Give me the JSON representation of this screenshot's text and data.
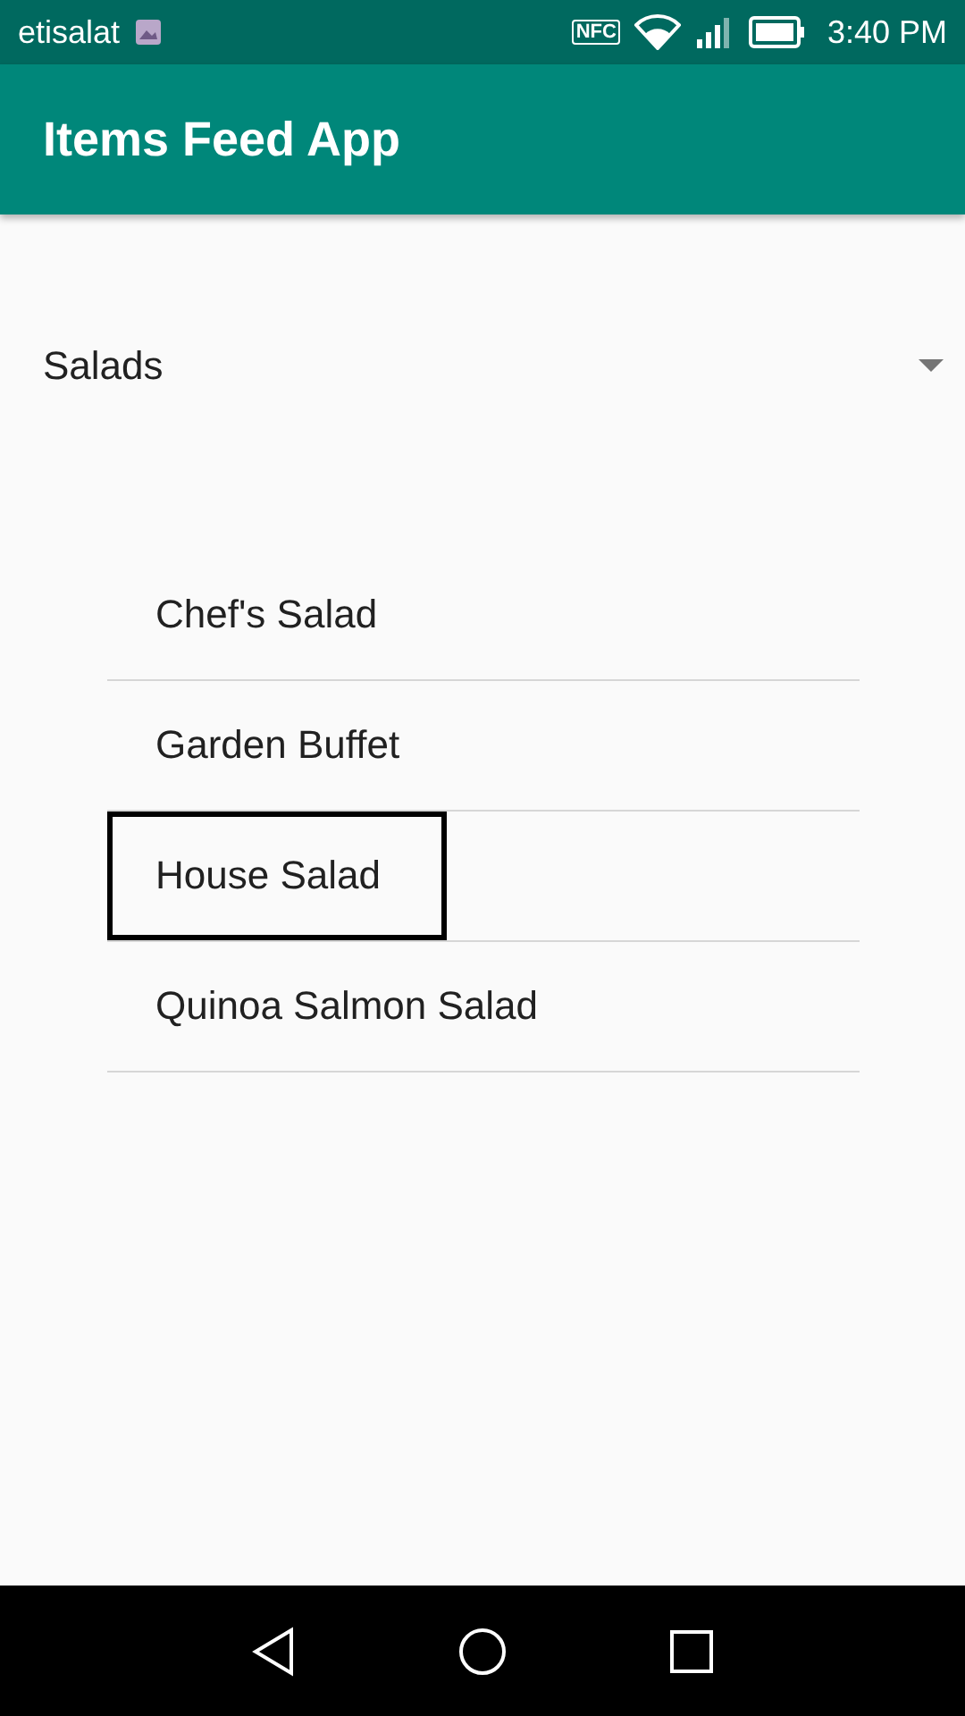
{
  "status_bar": {
    "carrier": "etisalat",
    "nfc": "NFC",
    "time": "3:40 PM"
  },
  "app_bar": {
    "title": "Items Feed App"
  },
  "spinner": {
    "value": "Salads"
  },
  "items": [
    {
      "label": "Chef's Salad",
      "selected": false
    },
    {
      "label": "Garden Buffet",
      "selected": false
    },
    {
      "label": "House Salad",
      "selected": true
    },
    {
      "label": "Quinoa Salmon Salad",
      "selected": false
    }
  ]
}
